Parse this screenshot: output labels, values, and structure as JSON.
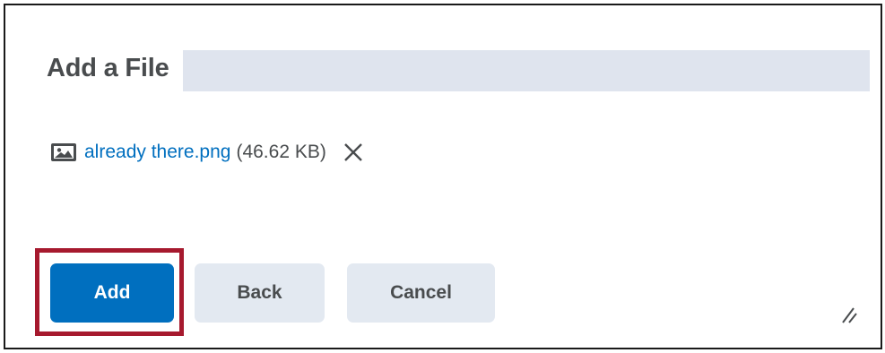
{
  "dialog": {
    "title": "Add a File"
  },
  "file": {
    "icon": "image-file-icon",
    "name": "already there.png",
    "size": "(46.62 KB)",
    "remove_icon": "close-icon"
  },
  "buttons": {
    "add_label": "Add",
    "back_label": "Back",
    "cancel_label": "Cancel"
  },
  "colors": {
    "primary": "#006fbf",
    "secondary_button": "#e3e9f1",
    "highlight": "#a6192e",
    "text": "#494c4e"
  }
}
